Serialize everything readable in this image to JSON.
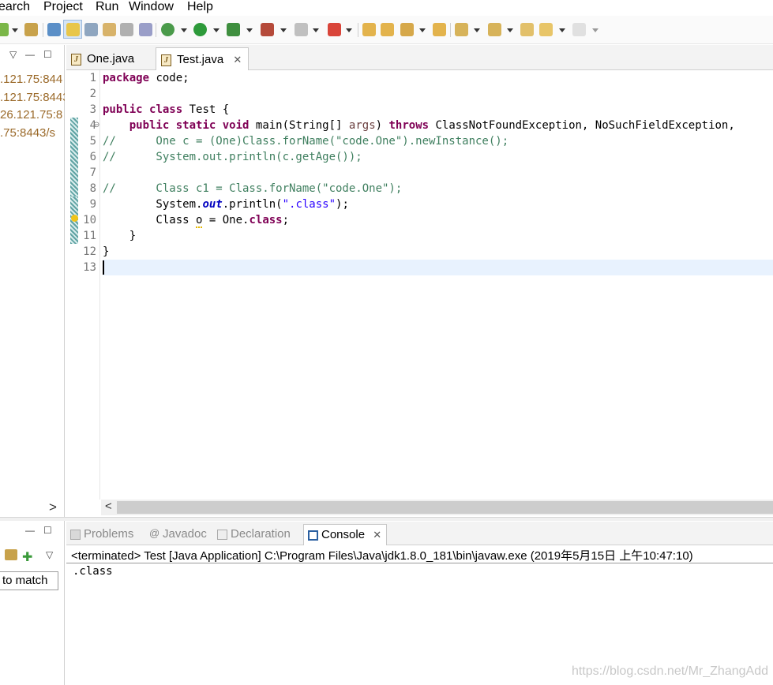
{
  "menu": {
    "items": [
      {
        "label": "earch"
      },
      {
        "label": "Project"
      },
      {
        "label": "Run"
      },
      {
        "label": "Window"
      },
      {
        "label": "Help"
      }
    ]
  },
  "toolbar": {
    "icons": [
      "open-type-icon",
      "search-icon",
      "mark-occurrences-icon",
      "highlight-icon",
      "next-annotation-icon",
      "toggle-block-icon",
      "show-whitespace-icon",
      "debug-icon",
      "run-icon",
      "coverage-icon",
      "external-tools-icon",
      "terminate-icon",
      "skip-breakpoints-icon",
      "open-folder-icon",
      "new-folder-icon",
      "brush-icon",
      "folder-icon",
      "next-edit-icon",
      "prev-edit-icon",
      "back-icon",
      "forward-icon"
    ]
  },
  "left_panel": {
    "hosts": [
      ".121.75:844",
      ".121.75:8443",
      "26.121.75:8",
      ".75:8443/s"
    ],
    "scroll_arrow": ">",
    "filter_text": "to match",
    "collapse_label": "▽",
    "minimize_label": "—",
    "maximize_label": "☐"
  },
  "editor": {
    "tabs": [
      {
        "label": "One.java",
        "active": false
      },
      {
        "label": "Test.java",
        "active": true
      }
    ],
    "line_numbers": [
      "1",
      "2",
      "3",
      "4",
      "5",
      "6",
      "7",
      "8",
      "9",
      "10",
      "11",
      "12",
      "13"
    ],
    "lines": [
      [
        {
          "t": "package",
          "c": "kw"
        },
        {
          "t": " code;",
          "c": ""
        }
      ],
      [],
      [
        {
          "t": "public",
          "c": "kw"
        },
        {
          "t": " ",
          "c": ""
        },
        {
          "t": "class",
          "c": "kw"
        },
        {
          "t": " Test {",
          "c": ""
        }
      ],
      [
        {
          "t": "    ",
          "c": ""
        },
        {
          "t": "public",
          "c": "kw"
        },
        {
          "t": " ",
          "c": ""
        },
        {
          "t": "static",
          "c": "kw"
        },
        {
          "t": " ",
          "c": ""
        },
        {
          "t": "void",
          "c": "kw"
        },
        {
          "t": " main(String[] ",
          "c": ""
        },
        {
          "t": "args",
          "c": "var"
        },
        {
          "t": ") ",
          "c": ""
        },
        {
          "t": "throws",
          "c": "kw"
        },
        {
          "t": " ClassNotFoundException, NoSuchFieldException,",
          "c": ""
        }
      ],
      [
        {
          "t": "//      One c = (One)Class.forName(\"code.One\").newInstance();",
          "c": "cm"
        }
      ],
      [
        {
          "t": "//      System.out.println(c.getAge());",
          "c": "cm"
        }
      ],
      [],
      [
        {
          "t": "//      Class c1 = Class.forName(\"code.One\");",
          "c": "cm"
        }
      ],
      [
        {
          "t": "        System.",
          "c": ""
        },
        {
          "t": "out",
          "c": "fi"
        },
        {
          "t": ".println(",
          "c": ""
        },
        {
          "t": "\".class\"",
          "c": "st"
        },
        {
          "t": ");",
          "c": ""
        }
      ],
      [
        {
          "t": "        Class ",
          "c": ""
        },
        {
          "t": "o",
          "c": "warn"
        },
        {
          "t": " = One.",
          "c": ""
        },
        {
          "t": "class",
          "c": "kw"
        },
        {
          "t": ";",
          "c": ""
        }
      ],
      [
        {
          "t": "    }",
          "c": ""
        }
      ],
      [
        {
          "t": "}",
          "c": ""
        }
      ],
      []
    ],
    "fold_marker": "⊖",
    "scroll_arrow": "<"
  },
  "bottom": {
    "tabs": [
      {
        "label": "Problems",
        "icon": "problems-icon",
        "active": false
      },
      {
        "label": "Javadoc",
        "icon": "at-icon",
        "active": false
      },
      {
        "label": "Declaration",
        "icon": "declaration-icon",
        "active": false
      },
      {
        "label": "Console",
        "icon": "console-icon",
        "active": true
      }
    ],
    "console_header": "<terminated> Test [Java Application] C:\\Program Files\\Java\\jdk1.8.0_181\\bin\\javaw.exe (2019年5月15日 上午10:47:10)",
    "console_output": ".class",
    "watermark": "https://blog.csdn.net/Mr_ZhangAdd"
  },
  "colors": {
    "keyword": "#7f0055",
    "comment": "#3f7f5f",
    "string": "#2a00ff",
    "field": "#0000c0",
    "current_line": "#e8f2fe",
    "host_text": "#9b6a2a"
  }
}
